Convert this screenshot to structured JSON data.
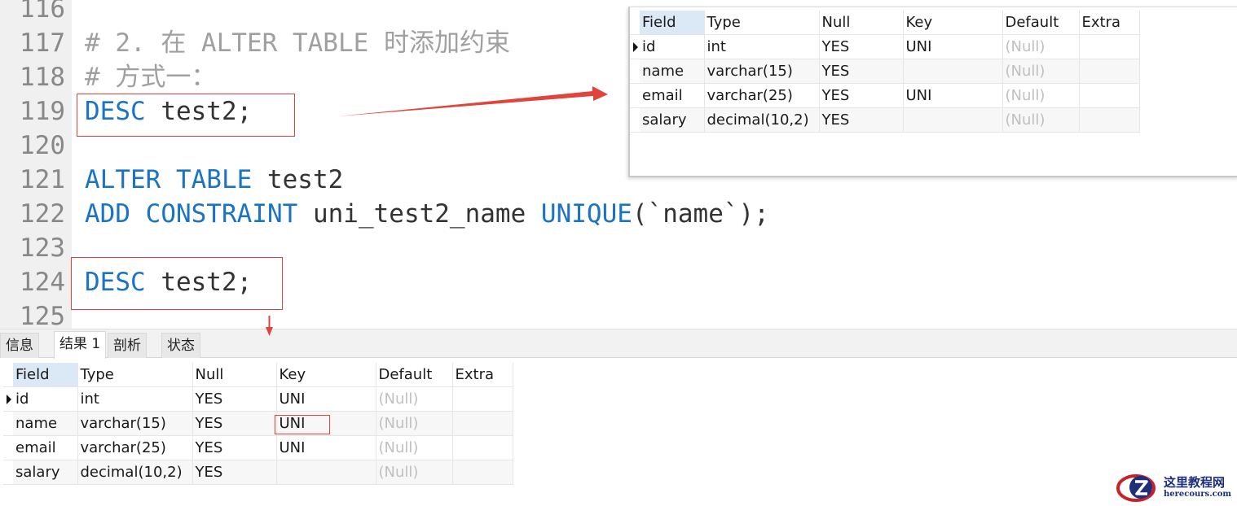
{
  "editor": {
    "lines": [
      {
        "num": "116",
        "segments": []
      },
      {
        "num": "117",
        "segments": [
          {
            "t": "# 2. 在 ALTER TABLE 时添加约束",
            "c": "cm"
          }
        ]
      },
      {
        "num": "118",
        "segments": [
          {
            "t": "# 方式一：",
            "c": "cm"
          }
        ]
      },
      {
        "num": "119",
        "segments": [
          {
            "t": "DESC",
            "c": "kw"
          },
          {
            "t": " test2;",
            "c": "id"
          }
        ]
      },
      {
        "num": "120",
        "segments": []
      },
      {
        "num": "121",
        "segments": [
          {
            "t": "ALTER TABLE",
            "c": "kw"
          },
          {
            "t": " test2",
            "c": "id"
          }
        ]
      },
      {
        "num": "122",
        "segments": [
          {
            "t": "ADD CONSTRAINT",
            "c": "kw"
          },
          {
            "t": " uni_test2_name ",
            "c": "id"
          },
          {
            "t": "UNIQUE",
            "c": "kw"
          },
          {
            "t": "(`name`);",
            "c": "id"
          }
        ]
      },
      {
        "num": "123",
        "segments": []
      },
      {
        "num": "124",
        "segments": [
          {
            "t": "DESC",
            "c": "kw"
          },
          {
            "t": " test2;",
            "c": "id"
          }
        ]
      },
      {
        "num": "125",
        "segments": []
      }
    ]
  },
  "popup_table": {
    "columns": [
      "Field",
      "Type",
      "Null",
      "Key",
      "Default",
      "Extra"
    ],
    "rows": [
      [
        "id",
        "int",
        "YES",
        "UNI",
        "(Null)",
        ""
      ],
      [
        "name",
        "varchar(15)",
        "YES",
        "",
        "(Null)",
        ""
      ],
      [
        "email",
        "varchar(25)",
        "YES",
        "UNI",
        "(Null)",
        ""
      ],
      [
        "salary",
        "decimal(10,2)",
        "YES",
        "",
        "(Null)",
        ""
      ]
    ]
  },
  "result_panel": {
    "tabs": [
      "信息",
      "结果 1",
      "剖析",
      "状态"
    ],
    "active_tab": 1,
    "table": {
      "columns": [
        "Field",
        "Type",
        "Null",
        "Key",
        "Default",
        "Extra"
      ],
      "rows": [
        [
          "id",
          "int",
          "YES",
          "UNI",
          "(Null)",
          ""
        ],
        [
          "name",
          "varchar(15)",
          "YES",
          "UNI",
          "(Null)",
          ""
        ],
        [
          "email",
          "varchar(25)",
          "YES",
          "UNI",
          "(Null)",
          ""
        ],
        [
          "salary",
          "decimal(10,2)",
          "YES",
          "",
          "(Null)",
          ""
        ]
      ]
    }
  },
  "watermark": {
    "title": "这里教程网",
    "subtitle": "herecours.com"
  },
  "colors": {
    "keyword": "#1a73c4",
    "identifier": "#333333",
    "comment": "#a0a0a0",
    "annotation": "#e0443c",
    "null_value": "#c0c0c0",
    "header_highlight": "#dbe8f6"
  }
}
